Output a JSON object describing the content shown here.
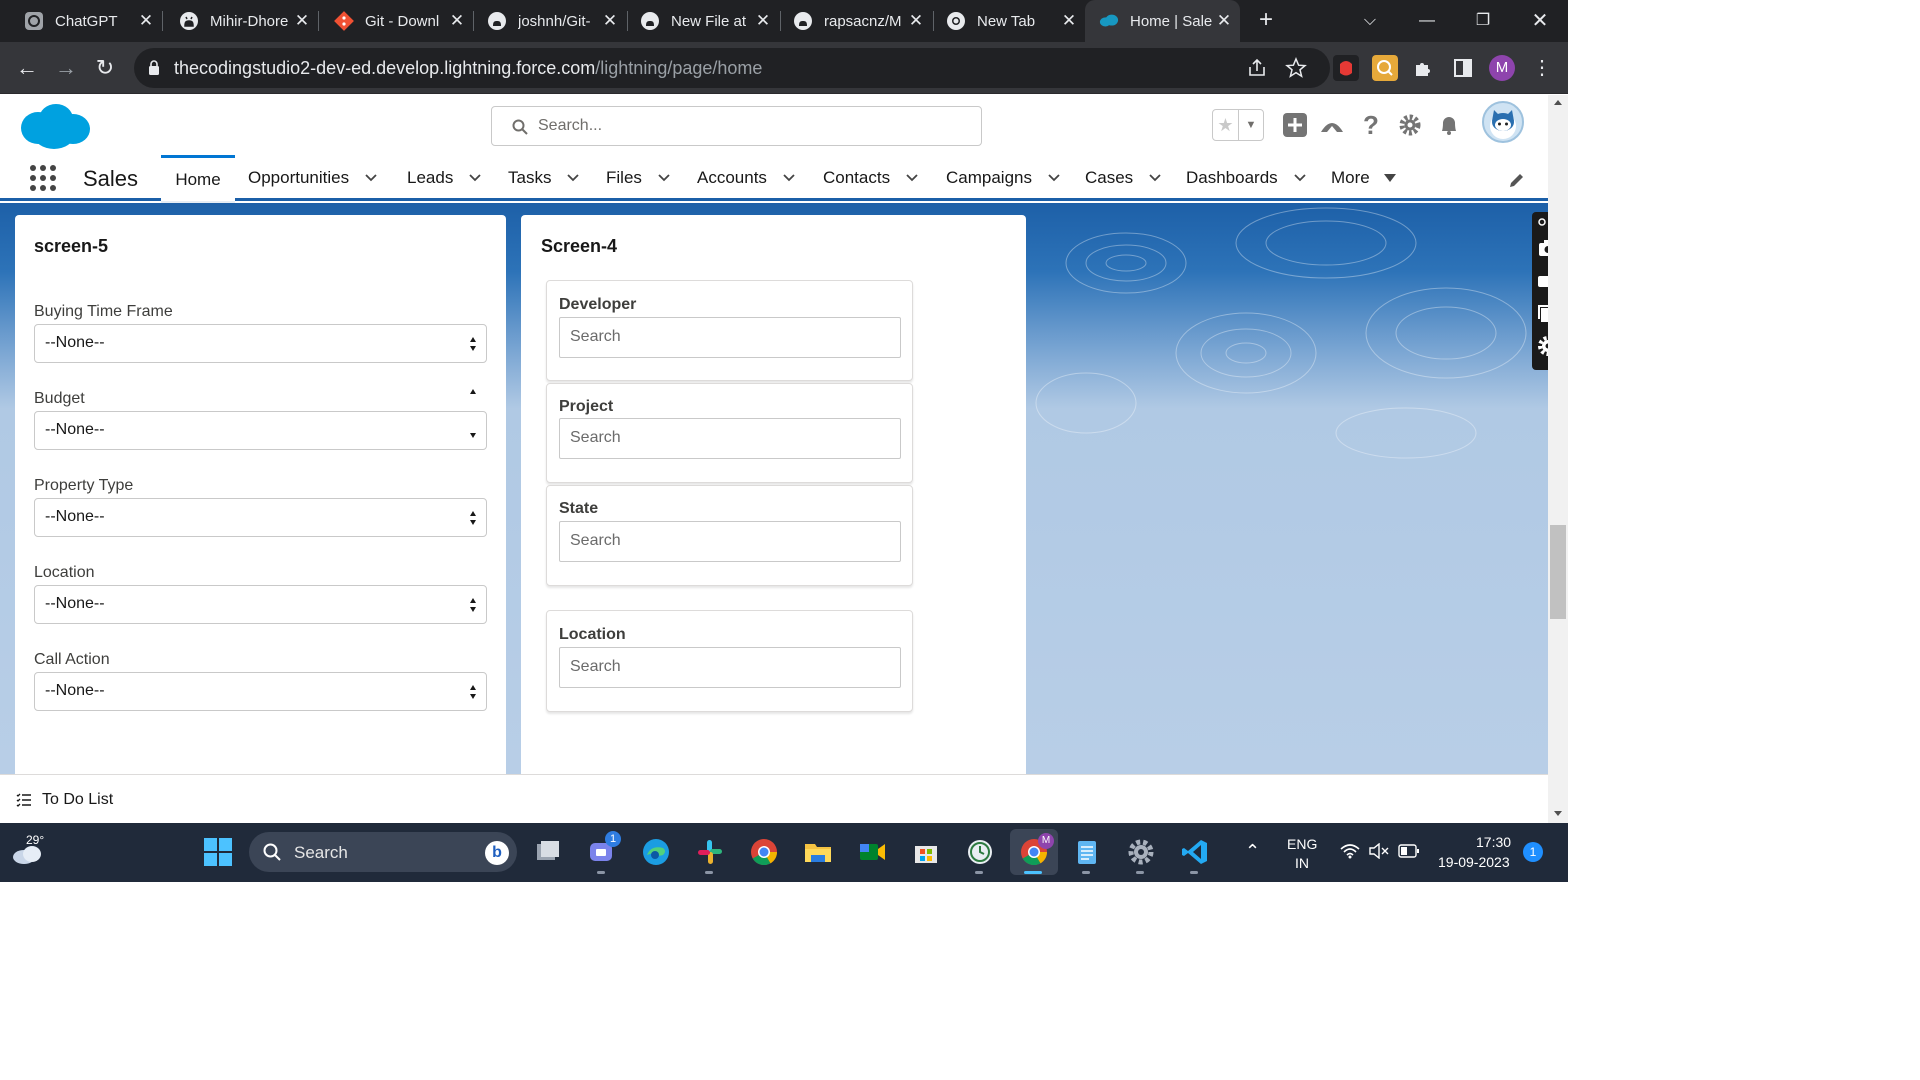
{
  "browser": {
    "tabs": [
      {
        "title": "ChatGPT",
        "icon": "chatgpt-icon"
      },
      {
        "title": "Mihir-Dhore",
        "icon": "github-icon"
      },
      {
        "title": "Git - Downl",
        "icon": "git-icon"
      },
      {
        "title": "joshnh/Git-",
        "icon": "github-icon"
      },
      {
        "title": "New File at",
        "icon": "github-icon"
      },
      {
        "title": "rapsacnz/M",
        "icon": "github-icon"
      },
      {
        "title": "New Tab",
        "icon": "chrome-icon"
      },
      {
        "title": "Home | Sale",
        "icon": "salesforce-icon",
        "active": true
      }
    ],
    "url_host": "thecodingstudio2-dev-ed.develop.lightning.force.com",
    "url_path": "/lightning/page/home",
    "profile_initial": "M"
  },
  "salesforce": {
    "search_placeholder": "Search...",
    "app_name": "Sales",
    "nav": [
      {
        "label": "Home",
        "active": true
      },
      {
        "label": "Opportunities"
      },
      {
        "label": "Leads"
      },
      {
        "label": "Tasks"
      },
      {
        "label": "Files"
      },
      {
        "label": "Accounts"
      },
      {
        "label": "Contacts"
      },
      {
        "label": "Campaigns"
      },
      {
        "label": "Cases"
      },
      {
        "label": "Dashboards"
      },
      {
        "label": "More"
      }
    ]
  },
  "screen5": {
    "title": "screen-5",
    "fields": [
      {
        "label": "Buying Time Frame",
        "value": "--None--"
      },
      {
        "label": "Budget",
        "value": "--None--"
      },
      {
        "label": "Property Type",
        "value": "--None--"
      },
      {
        "label": "Location",
        "value": "--None--"
      },
      {
        "label": "Call Action",
        "value": "--None--"
      }
    ]
  },
  "screen4": {
    "title": "Screen-4",
    "lookups": [
      {
        "label": "Developer",
        "placeholder": "Search"
      },
      {
        "label": "Project",
        "placeholder": "Search"
      },
      {
        "label": "State",
        "placeholder": "Search"
      },
      {
        "label": "Location",
        "placeholder": "Search"
      }
    ]
  },
  "utility_bar": {
    "todo_label": "To Do List"
  },
  "taskbar": {
    "weather_temp": "29°",
    "search_placeholder": "Search",
    "lang": "ENG",
    "region": "IN",
    "time": "17:30",
    "date": "19-09-2023",
    "notification_count": "1",
    "teams_badge": "1"
  },
  "colors": {
    "sf_blue": "#0176d3",
    "chrome_dark": "#202124",
    "taskbar": "#202a3a"
  }
}
